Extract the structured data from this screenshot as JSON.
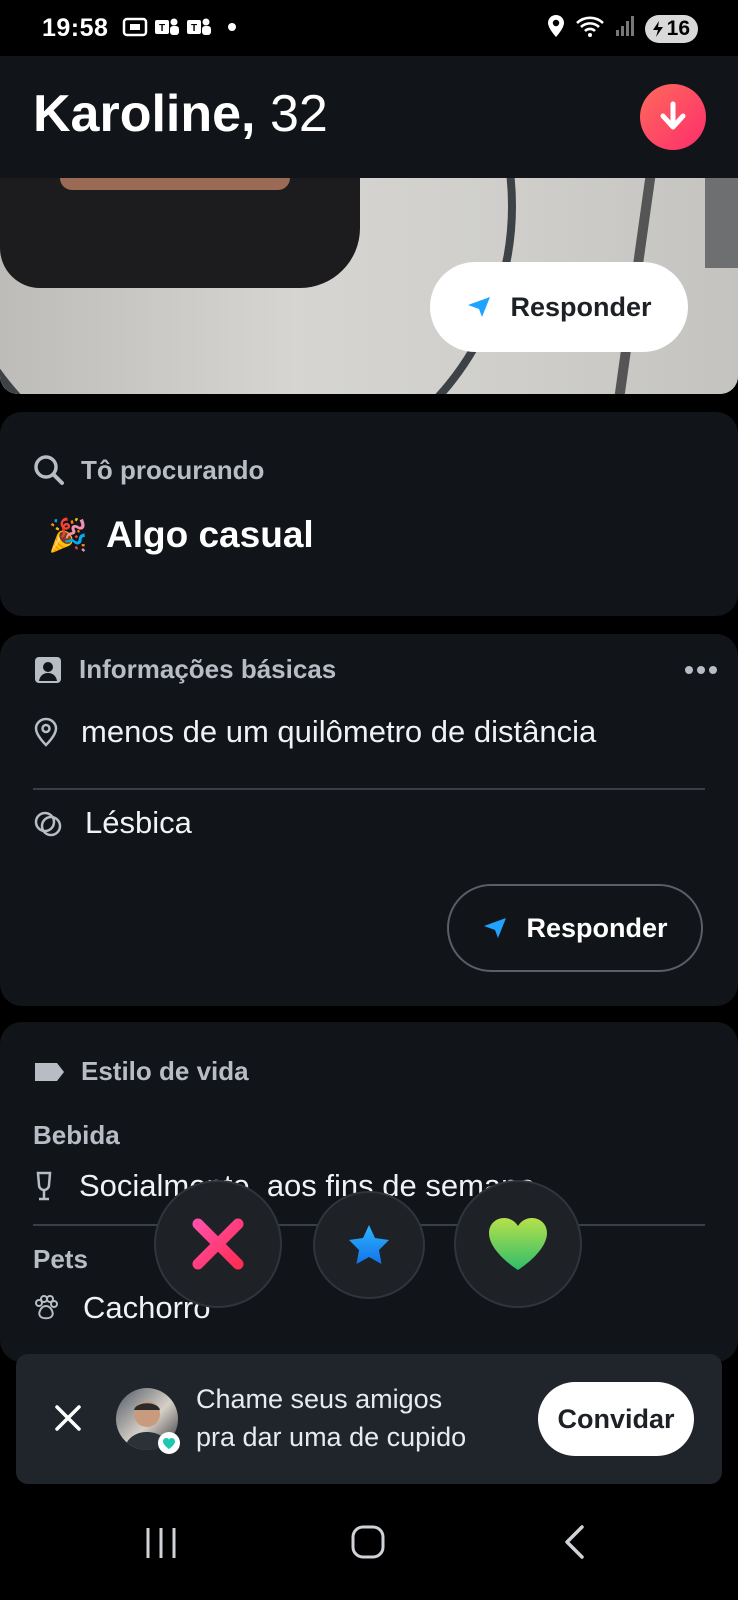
{
  "status_bar": {
    "time": "19:58",
    "battery": "16",
    "icons_left": [
      "screenshot-icon",
      "teams-icon",
      "teams-icon",
      "dot"
    ],
    "icons_right": [
      "location-icon",
      "wifi-icon",
      "signal-icon",
      "battery-icon"
    ]
  },
  "header": {
    "name": "Karoline,",
    "age": "32",
    "down_button_icon": "arrow-down-icon"
  },
  "photo": {
    "reply_label": "Responder"
  },
  "looking_for": {
    "title": "Tô procurando",
    "emoji": "🎉",
    "value": "Algo casual"
  },
  "basic_info": {
    "title": "Informações básicas",
    "distance": "menos de um quilômetro de distância",
    "orientation": "Lésbica",
    "reply_label": "Responder"
  },
  "lifestyle": {
    "title": "Estilo de vida",
    "drink_label": "Bebida",
    "drink_value": "Socialmente, aos fins de semana",
    "pets_label": "Pets",
    "pets_value": "Cachorro"
  },
  "actions": {
    "nope_icon": "x-icon",
    "super_like_icon": "star-icon",
    "like_icon": "heart-icon"
  },
  "invite": {
    "line1": "Chame seus amigos",
    "line2": "pra dar uma de cupido",
    "button": "Convidar"
  },
  "colors": {
    "background": "#000000",
    "card": "#111418",
    "accent_red": "#fd2d6b",
    "accent_blue": "#1fa3ff",
    "accent_green": "#7bd130"
  }
}
